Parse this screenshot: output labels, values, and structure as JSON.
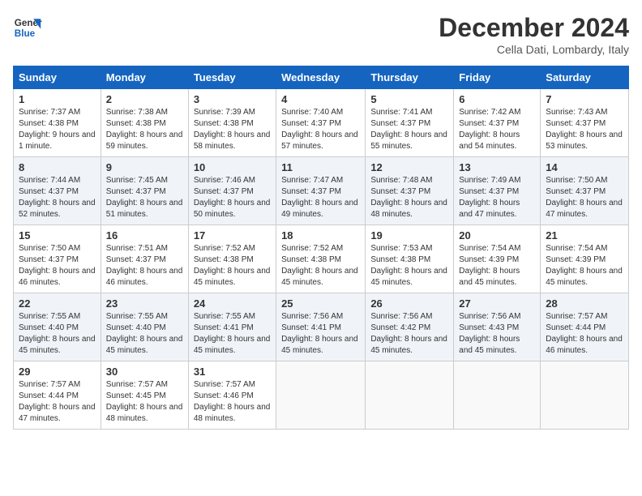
{
  "header": {
    "logo_line1": "General",
    "logo_line2": "Blue",
    "month": "December 2024",
    "location": "Cella Dati, Lombardy, Italy"
  },
  "days_of_week": [
    "Sunday",
    "Monday",
    "Tuesday",
    "Wednesday",
    "Thursday",
    "Friday",
    "Saturday"
  ],
  "weeks": [
    [
      {
        "day": "1",
        "sunrise": "Sunrise: 7:37 AM",
        "sunset": "Sunset: 4:38 PM",
        "daylight": "Daylight: 9 hours and 1 minute."
      },
      {
        "day": "2",
        "sunrise": "Sunrise: 7:38 AM",
        "sunset": "Sunset: 4:38 PM",
        "daylight": "Daylight: 8 hours and 59 minutes."
      },
      {
        "day": "3",
        "sunrise": "Sunrise: 7:39 AM",
        "sunset": "Sunset: 4:38 PM",
        "daylight": "Daylight: 8 hours and 58 minutes."
      },
      {
        "day": "4",
        "sunrise": "Sunrise: 7:40 AM",
        "sunset": "Sunset: 4:37 PM",
        "daylight": "Daylight: 8 hours and 57 minutes."
      },
      {
        "day": "5",
        "sunrise": "Sunrise: 7:41 AM",
        "sunset": "Sunset: 4:37 PM",
        "daylight": "Daylight: 8 hours and 55 minutes."
      },
      {
        "day": "6",
        "sunrise": "Sunrise: 7:42 AM",
        "sunset": "Sunset: 4:37 PM",
        "daylight": "Daylight: 8 hours and 54 minutes."
      },
      {
        "day": "7",
        "sunrise": "Sunrise: 7:43 AM",
        "sunset": "Sunset: 4:37 PM",
        "daylight": "Daylight: 8 hours and 53 minutes."
      }
    ],
    [
      {
        "day": "8",
        "sunrise": "Sunrise: 7:44 AM",
        "sunset": "Sunset: 4:37 PM",
        "daylight": "Daylight: 8 hours and 52 minutes."
      },
      {
        "day": "9",
        "sunrise": "Sunrise: 7:45 AM",
        "sunset": "Sunset: 4:37 PM",
        "daylight": "Daylight: 8 hours and 51 minutes."
      },
      {
        "day": "10",
        "sunrise": "Sunrise: 7:46 AM",
        "sunset": "Sunset: 4:37 PM",
        "daylight": "Daylight: 8 hours and 50 minutes."
      },
      {
        "day": "11",
        "sunrise": "Sunrise: 7:47 AM",
        "sunset": "Sunset: 4:37 PM",
        "daylight": "Daylight: 8 hours and 49 minutes."
      },
      {
        "day": "12",
        "sunrise": "Sunrise: 7:48 AM",
        "sunset": "Sunset: 4:37 PM",
        "daylight": "Daylight: 8 hours and 48 minutes."
      },
      {
        "day": "13",
        "sunrise": "Sunrise: 7:49 AM",
        "sunset": "Sunset: 4:37 PM",
        "daylight": "Daylight: 8 hours and 47 minutes."
      },
      {
        "day": "14",
        "sunrise": "Sunrise: 7:50 AM",
        "sunset": "Sunset: 4:37 PM",
        "daylight": "Daylight: 8 hours and 47 minutes."
      }
    ],
    [
      {
        "day": "15",
        "sunrise": "Sunrise: 7:50 AM",
        "sunset": "Sunset: 4:37 PM",
        "daylight": "Daylight: 8 hours and 46 minutes."
      },
      {
        "day": "16",
        "sunrise": "Sunrise: 7:51 AM",
        "sunset": "Sunset: 4:37 PM",
        "daylight": "Daylight: 8 hours and 46 minutes."
      },
      {
        "day": "17",
        "sunrise": "Sunrise: 7:52 AM",
        "sunset": "Sunset: 4:38 PM",
        "daylight": "Daylight: 8 hours and 45 minutes."
      },
      {
        "day": "18",
        "sunrise": "Sunrise: 7:52 AM",
        "sunset": "Sunset: 4:38 PM",
        "daylight": "Daylight: 8 hours and 45 minutes."
      },
      {
        "day": "19",
        "sunrise": "Sunrise: 7:53 AM",
        "sunset": "Sunset: 4:38 PM",
        "daylight": "Daylight: 8 hours and 45 minutes."
      },
      {
        "day": "20",
        "sunrise": "Sunrise: 7:54 AM",
        "sunset": "Sunset: 4:39 PM",
        "daylight": "Daylight: 8 hours and 45 minutes."
      },
      {
        "day": "21",
        "sunrise": "Sunrise: 7:54 AM",
        "sunset": "Sunset: 4:39 PM",
        "daylight": "Daylight: 8 hours and 45 minutes."
      }
    ],
    [
      {
        "day": "22",
        "sunrise": "Sunrise: 7:55 AM",
        "sunset": "Sunset: 4:40 PM",
        "daylight": "Daylight: 8 hours and 45 minutes."
      },
      {
        "day": "23",
        "sunrise": "Sunrise: 7:55 AM",
        "sunset": "Sunset: 4:40 PM",
        "daylight": "Daylight: 8 hours and 45 minutes."
      },
      {
        "day": "24",
        "sunrise": "Sunrise: 7:55 AM",
        "sunset": "Sunset: 4:41 PM",
        "daylight": "Daylight: 8 hours and 45 minutes."
      },
      {
        "day": "25",
        "sunrise": "Sunrise: 7:56 AM",
        "sunset": "Sunset: 4:41 PM",
        "daylight": "Daylight: 8 hours and 45 minutes."
      },
      {
        "day": "26",
        "sunrise": "Sunrise: 7:56 AM",
        "sunset": "Sunset: 4:42 PM",
        "daylight": "Daylight: 8 hours and 45 minutes."
      },
      {
        "day": "27",
        "sunrise": "Sunrise: 7:56 AM",
        "sunset": "Sunset: 4:43 PM",
        "daylight": "Daylight: 8 hours and 45 minutes."
      },
      {
        "day": "28",
        "sunrise": "Sunrise: 7:57 AM",
        "sunset": "Sunset: 4:44 PM",
        "daylight": "Daylight: 8 hours and 46 minutes."
      }
    ],
    [
      {
        "day": "29",
        "sunrise": "Sunrise: 7:57 AM",
        "sunset": "Sunset: 4:44 PM",
        "daylight": "Daylight: 8 hours and 47 minutes."
      },
      {
        "day": "30",
        "sunrise": "Sunrise: 7:57 AM",
        "sunset": "Sunset: 4:45 PM",
        "daylight": "Daylight: 8 hours and 48 minutes."
      },
      {
        "day": "31",
        "sunrise": "Sunrise: 7:57 AM",
        "sunset": "Sunset: 4:46 PM",
        "daylight": "Daylight: 8 hours and 48 minutes."
      },
      null,
      null,
      null,
      null
    ]
  ]
}
